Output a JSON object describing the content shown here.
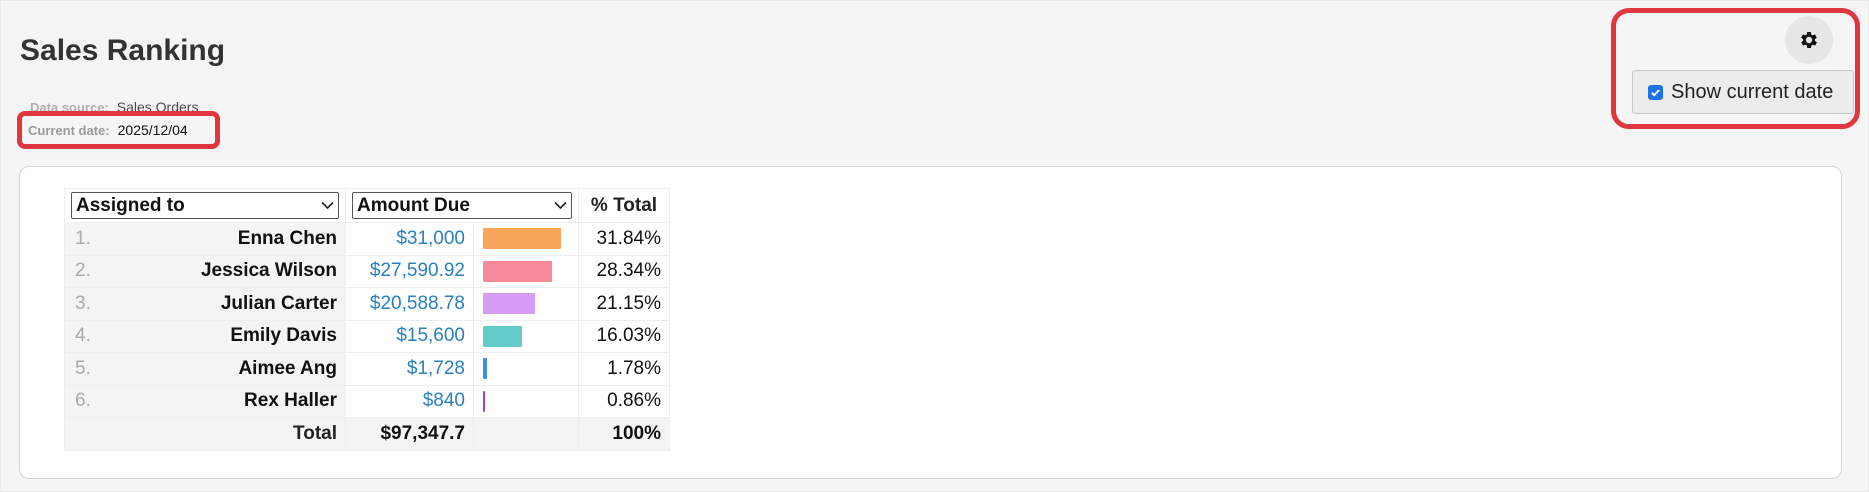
{
  "header": {
    "title": "Sales Ranking",
    "data_source_label": "Data source:",
    "data_source_value": "Sales Orders",
    "current_date_label": "Current date:",
    "current_date_value": "2025/12/04"
  },
  "tools": {
    "gear_icon": "gear-icon",
    "show_current_date_label": "Show current date",
    "show_current_date_checked": true
  },
  "table": {
    "group_by": "Assigned to",
    "measure": "Amount Due",
    "pct_header": "% Total",
    "rows": [
      {
        "rank": "1.",
        "name": "Enna Chen",
        "amount": "$31,000",
        "pct": "31.84%",
        "share": 0.3184,
        "color": "#f9a65a"
      },
      {
        "rank": "2.",
        "name": "Jessica Wilson",
        "amount": "$27,590.92",
        "pct": "28.34%",
        "share": 0.2834,
        "color": "#f78a9a"
      },
      {
        "rank": "3.",
        "name": "Julian Carter",
        "amount": "$20,588.78",
        "pct": "21.15%",
        "share": 0.2115,
        "color": "#d69cf5"
      },
      {
        "rank": "4.",
        "name": "Emily Davis",
        "amount": "$15,600",
        "pct": "16.03%",
        "share": 0.1603,
        "color": "#62cbc7"
      },
      {
        "rank": "5.",
        "name": "Aimee Ang",
        "amount": "$1,728",
        "pct": "1.78%",
        "share": 0.0178,
        "color": "#3d8fe0"
      },
      {
        "rank": "6.",
        "name": "Rex Haller",
        "amount": "$840",
        "pct": "0.86%",
        "share": 0.0086,
        "color": "#9b3fd6"
      }
    ],
    "total_label": "Total",
    "total_amount": "$97,347.7",
    "total_pct": "100%"
  }
}
